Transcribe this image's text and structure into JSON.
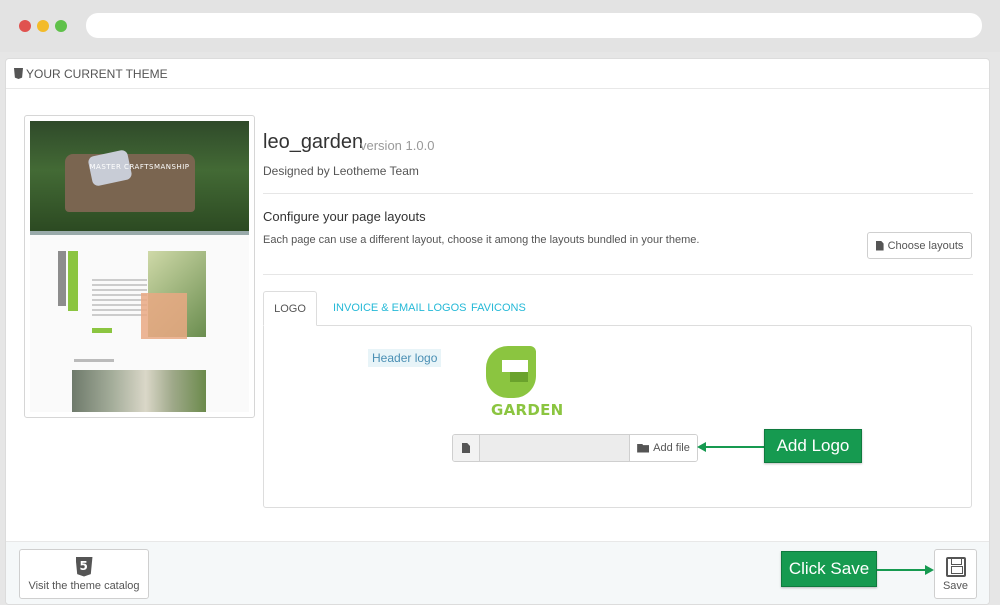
{
  "panel": {
    "title": "YOUR CURRENT THEME"
  },
  "theme": {
    "name": "leo_garden",
    "version": "version 1.0.0",
    "author": "Designed by Leotheme Team",
    "preview_hero_text": "MASTER CRAFTSMANSHIP"
  },
  "layouts": {
    "title": "Configure your page layouts",
    "description": "Each page can use a different layout, choose it among the layouts bundled in your theme.",
    "button_label": "Choose layouts"
  },
  "tabs": [
    {
      "label": "LOGO",
      "active": true
    },
    {
      "label": "INVOICE & EMAIL LOGOS",
      "active": false
    },
    {
      "label": "FAVICONS",
      "active": false
    }
  ],
  "logo_tab": {
    "field_label": "Header logo",
    "logo_text": "GARDEN",
    "add_file_label": "Add file"
  },
  "footer": {
    "catalog_label": "Visit the theme catalog",
    "save_label": "Save"
  },
  "annotations": {
    "add_logo": "Add Logo",
    "click_save": "Click Save"
  },
  "colors": {
    "accent_link": "#25b9d7",
    "callout_green": "#169a50",
    "brand_green": "#8bc540"
  }
}
